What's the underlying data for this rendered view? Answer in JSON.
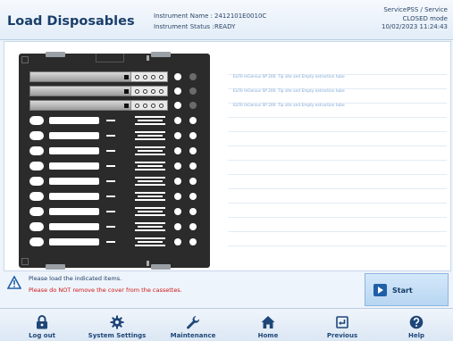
{
  "header": {
    "title": "Load Disposables",
    "instrument_name_label": "Instrument Name :",
    "instrument_name_value": "2412101E0010C",
    "instrument_status_label": "Instrument Status :",
    "instrument_status_value": "READY",
    "service_user": "ServicePSS / Service",
    "mode": "CLOSED mode",
    "datetime": "10/02/2023 11:24:43"
  },
  "notes": [
    "ELITe InGenius SP 200. Tip site and Empty extraction tube",
    "ELITe InGenius SP 200. Tip site and Empty extraction tube",
    "ELITe InGenius SP 200. Tip site and Empty extraction tube"
  ],
  "messages": {
    "line1": "Please load the indicated items.",
    "line2": "Please do NOT remove the cover from the cassettes."
  },
  "start_button": {
    "label": "Start"
  },
  "nav": [
    {
      "label": "Log out",
      "icon": "lock-icon"
    },
    {
      "label": "System Settings",
      "icon": "gear-icon"
    },
    {
      "label": "Maintenance",
      "icon": "wrench-icon"
    },
    {
      "label": "Home",
      "icon": "home-icon"
    },
    {
      "label": "Previous",
      "icon": "previous-icon"
    },
    {
      "label": "Help",
      "icon": "help-icon"
    }
  ],
  "colors": {
    "accent": "#1f5fa8",
    "warning_text": "#d01515",
    "note_text": "#7ea6d6"
  }
}
